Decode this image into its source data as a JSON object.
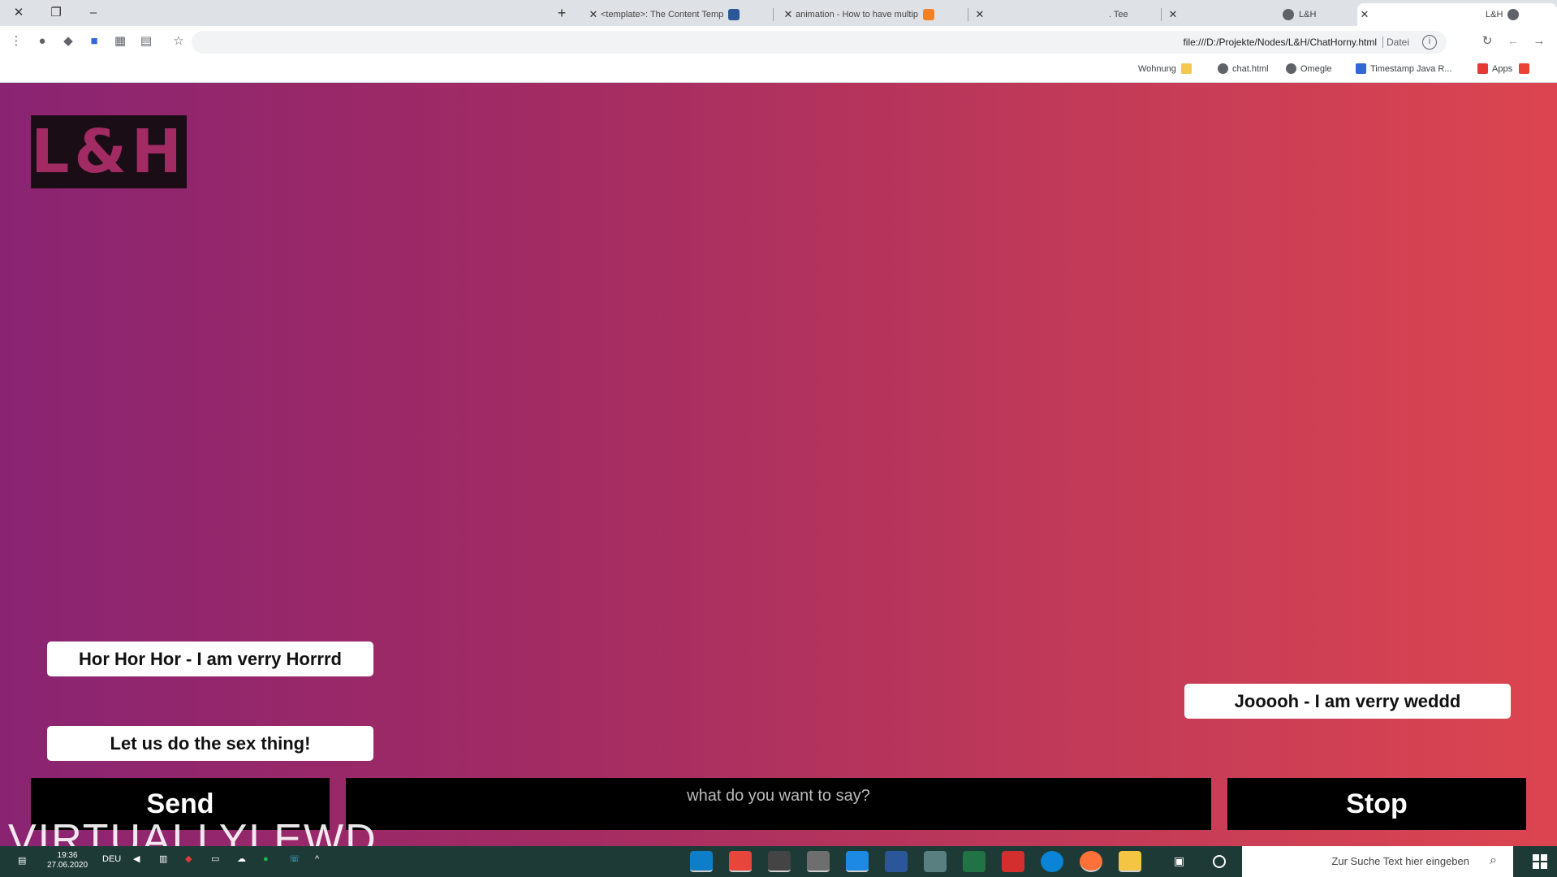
{
  "browser": {
    "tabs": [
      {
        "title": "L&H",
        "active": true
      },
      {
        "title": "L&H",
        "active": false
      },
      {
        "title": ". Tee",
        "active": false
      },
      {
        "title": "animation - How to have multip",
        "active": false
      },
      {
        "title": "<template>: The Content Temp",
        "active": false
      }
    ],
    "address": {
      "url": "file:///D:/Projekte/Nodes/L&H/ChatHorny.html",
      "scheme_label": "Datei"
    },
    "bookmarks": [
      "Apps",
      "Timestamp Java R...",
      "Omegle",
      "chat.html",
      "Wohnung"
    ]
  },
  "page": {
    "logo_text": "L&H",
    "messages": [
      {
        "text": "Hor Hor Hor - I am verry Horrrd",
        "side": "left"
      },
      {
        "text": "Let us do the sex thing!",
        "side": "left"
      },
      {
        "text": "Jooooh - I am verry weddd",
        "side": "right"
      }
    ],
    "controls": {
      "send_label": "Send",
      "stop_label": "Stop",
      "input_placeholder": "what do you want to say?"
    },
    "watermark": "VIRTUALLYLEWD"
  },
  "taskbar": {
    "search_placeholder": "Zur Suche Text hier eingeben",
    "clock_time": "19:36",
    "clock_date": "27.06.2020",
    "language": "DEU"
  },
  "colors": {
    "gradient_start": "#8a2472",
    "gradient_end": "#dc4550",
    "control_bg": "#000000",
    "bubble_bg": "#ffffff"
  }
}
